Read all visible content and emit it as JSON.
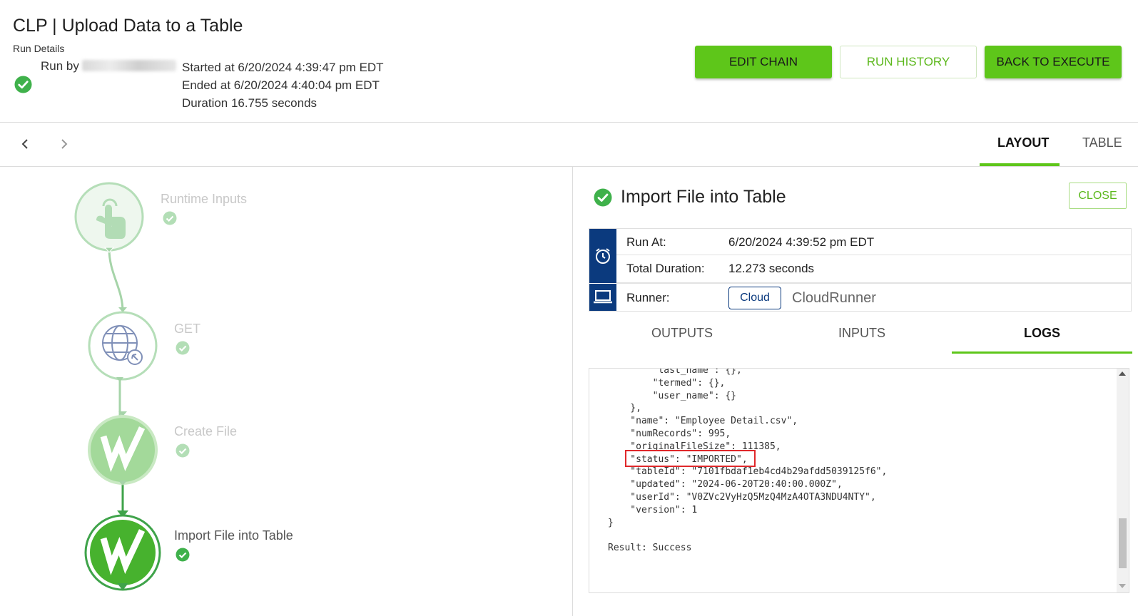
{
  "header": {
    "title": "CLP | Upload Data to a Table",
    "subtitle": "Run Details",
    "run_by_label": "Run by",
    "started": "Started at 6/20/2024 4:39:47 pm EDT",
    "ended": "Ended at 6/20/2024 4:40:04 pm EDT",
    "duration": "Duration 16.755 seconds",
    "buttons": {
      "edit_chain": "EDIT CHAIN",
      "run_history": "RUN HISTORY",
      "back_to_execute": "BACK TO EXECUTE"
    }
  },
  "toolbar": {
    "prev_icon": "chevron-left-icon",
    "next_icon": "chevron-right-icon",
    "tabs": [
      {
        "label": "LAYOUT",
        "active": true
      },
      {
        "label": "TABLE",
        "active": false
      }
    ]
  },
  "chain": {
    "nodes": [
      {
        "label": "Runtime Inputs",
        "icon": "touch-hand-icon",
        "status": "success"
      },
      {
        "label": "GET",
        "icon": "globe-cursor-icon",
        "status": "success"
      },
      {
        "label": "Create File",
        "icon": "workiva-w-icon",
        "status": "success"
      },
      {
        "label": "Import File into Table",
        "icon": "workiva-w-icon",
        "status": "success",
        "selected": true
      }
    ]
  },
  "detail": {
    "title": "Import File into Table",
    "close_label": "CLOSE",
    "info": {
      "run_at_label": "Run At:",
      "run_at_value": "6/20/2024 4:39:52 pm EDT",
      "total_duration_label": "Total Duration:",
      "total_duration_value": "12.273 seconds",
      "runner_label": "Runner:",
      "runner_badge": "Cloud",
      "runner_name": "CloudRunner",
      "alarm_icon": "alarm-clock-icon",
      "laptop_icon": "laptop-icon"
    },
    "tabs": [
      {
        "label": "OUTPUTS",
        "active": false
      },
      {
        "label": "INPUTS",
        "active": false
      },
      {
        "label": "LOGS",
        "active": true
      }
    ],
    "log_text": "        \"last_name\": {},\n        \"termed\": {},\n        \"user_name\": {}\n    },\n    \"name\": \"Employee Detail.csv\",\n    \"numRecords\": 995,\n    \"originalFileSize\": 111385,\n    \"status\": \"IMPORTED\",\n    \"tableId\": \"7101fbdaf1eb4cd4b29afdd5039125f6\",\n    \"updated\": \"2024-06-20T20:40:00.000Z\",\n    \"userId\": \"V0ZVc2VyHzQ5MzQ4MzA4OTA3NDU4NTY\",\n    \"version\": 1\n}\n\nResult: Success"
  },
  "colors": {
    "accent_green": "#5ec61a",
    "navy": "#0b3a7e",
    "success_green": "#3fb14b",
    "highlight_red": "#e0282b"
  }
}
